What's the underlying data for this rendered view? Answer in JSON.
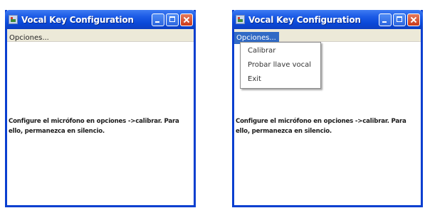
{
  "windows": [
    {
      "title": "Vocal Key Configuration",
      "menu": {
        "label": "Opciones..."
      },
      "message": "Configure el micrófono en opciones ->calibrar. Para ello, permanezca en silencio."
    },
    {
      "title": "Vocal Key Configuration",
      "menu": {
        "label": "Opciones..."
      },
      "dropdown": [
        "Calibrar",
        "Probar llave vocal",
        "Exit"
      ],
      "message": "Configure el micrófono en opciones ->calibrar. Para ello, permanezca en silencio."
    }
  ],
  "colors": {
    "titlebar": "#0a48d8",
    "window_border": "#0a3fd0",
    "menubar": "#ece9d8",
    "menu_highlight": "#316ac5",
    "close_button": "#cc3a1a"
  },
  "icons": {
    "app": "app-icon",
    "minimize": "minimize-icon",
    "maximize": "maximize-icon",
    "close": "close-icon"
  }
}
